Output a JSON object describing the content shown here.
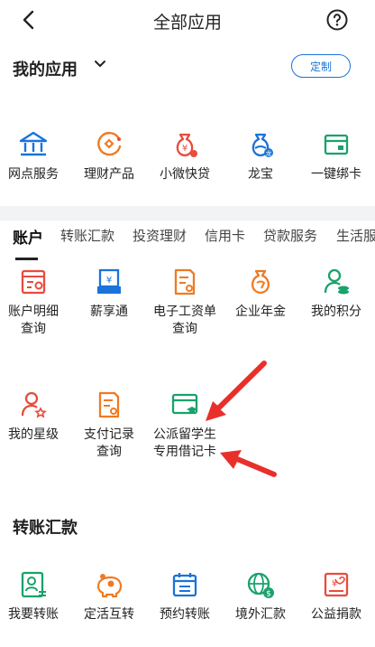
{
  "header": {
    "title": "全部应用",
    "back_icon": "chevron-left-icon",
    "help_icon": "help-circle-icon"
  },
  "my_apps": {
    "title": "我的应用",
    "customize_label": "定制",
    "items": [
      {
        "label": "网点服务",
        "icon": "bank-branch-icon"
      },
      {
        "label": "理财产品",
        "icon": "wealth-product-icon"
      },
      {
        "label": "小微快贷",
        "icon": "money-bag-yen-icon"
      },
      {
        "label": "龙宝",
        "icon": "dragon-bag-icon"
      },
      {
        "label": "一键绑卡",
        "icon": "card-bind-icon"
      }
    ]
  },
  "tabs": [
    "账户",
    "转账汇款",
    "投资理财",
    "信用卡",
    "贷款服务",
    "生活服"
  ],
  "account": {
    "items": [
      {
        "label": "账户明细\n查询",
        "icon": "account-detail-icon"
      },
      {
        "label": "薪享通",
        "icon": "salary-icon"
      },
      {
        "label": "电子工资单\n查询",
        "icon": "payslip-icon"
      },
      {
        "label": "企业年金",
        "icon": "annuity-bag-icon"
      },
      {
        "label": "我的积分",
        "icon": "points-user-icon"
      },
      {
        "label": "我的星级",
        "icon": "star-level-user-icon"
      },
      {
        "label": "支付记录\n查询",
        "icon": "payment-record-icon"
      },
      {
        "label": "公派留学生\n专用借记卡",
        "icon": "student-debit-card-icon"
      }
    ]
  },
  "transfer": {
    "title": "转账汇款",
    "items": [
      {
        "label": "我要转账",
        "icon": "transfer-user-icon"
      },
      {
        "label": "定活互转",
        "icon": "piggy-bank-icon"
      },
      {
        "label": "预约转账",
        "icon": "scheduled-transfer-icon"
      },
      {
        "label": "境外汇款",
        "icon": "globe-dollar-icon"
      },
      {
        "label": "公益捐款",
        "icon": "charity-donation-icon"
      }
    ]
  },
  "colors": {
    "accent": "#1a73d9",
    "red": "#e94b3c",
    "orange": "#f07a22",
    "green": "#1aa26b",
    "blue": "#1a73d9"
  }
}
